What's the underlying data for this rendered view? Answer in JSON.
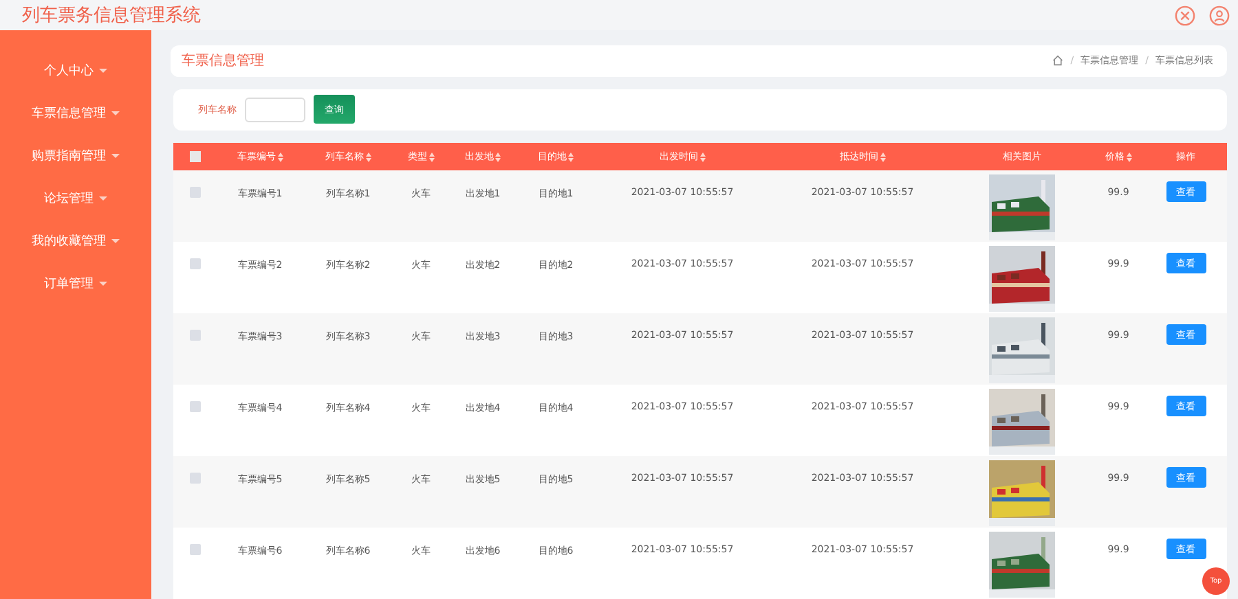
{
  "header": {
    "title": "列车票务信息管理系统"
  },
  "sidebar": {
    "items": [
      {
        "label": "个人中心"
      },
      {
        "label": "车票信息管理"
      },
      {
        "label": "购票指南管理"
      },
      {
        "label": "论坛管理"
      },
      {
        "label": "我的收藏管理"
      },
      {
        "label": "订单管理"
      }
    ]
  },
  "page_header": {
    "title": "车票信息管理",
    "breadcrumb": [
      "车票信息管理",
      "车票信息列表"
    ],
    "separator": "/"
  },
  "search": {
    "label": "列车名称",
    "button": "查询"
  },
  "table": {
    "select_all_checked": false,
    "columns": [
      {
        "label": "车票编号",
        "sortable": true
      },
      {
        "label": "列车名称",
        "sortable": true
      },
      {
        "label": "类型",
        "sortable": true
      },
      {
        "label": "出发地",
        "sortable": true
      },
      {
        "label": "目的地",
        "sortable": true
      },
      {
        "label": "出发时间",
        "sortable": true
      },
      {
        "label": "抵达时间",
        "sortable": true
      },
      {
        "label": "相关图片",
        "sortable": false
      },
      {
        "label": "价格",
        "sortable": true
      },
      {
        "label": "操作",
        "sortable": false
      }
    ],
    "rows": [
      {
        "cells": [
          "车票编号1",
          "列车名称1",
          "火车",
          "出发地1",
          "目的地1",
          "2021-03-07 10:55:57",
          "2021-03-07 10:55:57",
          "99.9"
        ],
        "checked": false,
        "action": "查看"
      },
      {
        "cells": [
          "车票编号2",
          "列车名称2",
          "火车",
          "出发地2",
          "目的地2",
          "2021-03-07 10:55:57",
          "2021-03-07 10:55:57",
          "99.9"
        ],
        "checked": false,
        "action": "查看"
      },
      {
        "cells": [
          "车票编号3",
          "列车名称3",
          "火车",
          "出发地3",
          "目的地3",
          "2021-03-07 10:55:57",
          "2021-03-07 10:55:57",
          "99.9"
        ],
        "checked": false,
        "action": "查看"
      },
      {
        "cells": [
          "车票编号4",
          "列车名称4",
          "火车",
          "出发地4",
          "目的地4",
          "2021-03-07 10:55:57",
          "2021-03-07 10:55:57",
          "99.9"
        ],
        "checked": false,
        "action": "查看"
      },
      {
        "cells": [
          "车票编号5",
          "列车名称5",
          "火车",
          "出发地5",
          "目的地5",
          "2021-03-07 10:55:57",
          "2021-03-07 10:55:57",
          "99.9"
        ],
        "checked": false,
        "action": "查看"
      },
      {
        "cells": [
          "车票编号6",
          "列车名称6",
          "火车",
          "出发地6",
          "目的地6",
          "2021-03-07 10:55:57",
          "2021-03-07 10:55:57",
          "99.9"
        ],
        "checked": false,
        "action": "查看"
      }
    ]
  },
  "top_button": "Top"
}
